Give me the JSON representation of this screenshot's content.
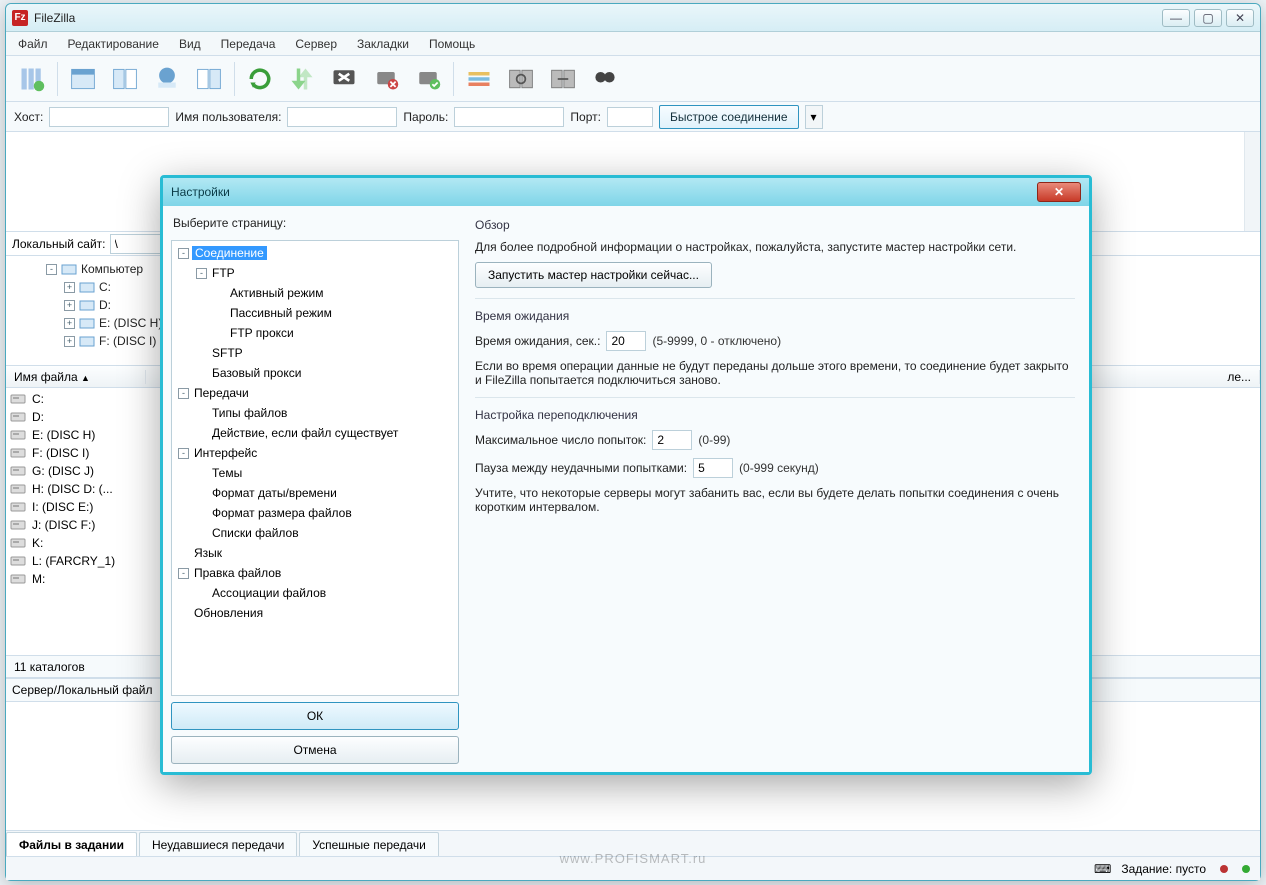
{
  "app": {
    "title": "FileZilla"
  },
  "menu": [
    "Файл",
    "Редактирование",
    "Вид",
    "Передача",
    "Сервер",
    "Закладки",
    "Помощь"
  ],
  "quickconnect": {
    "host_label": "Хост:",
    "user_label": "Имя пользователя:",
    "pass_label": "Пароль:",
    "port_label": "Порт:",
    "button": "Быстрое соединение"
  },
  "local": {
    "site_label": "Локальный сайт:",
    "path": "\\",
    "tree": [
      {
        "label": "Компьютер",
        "indent": 0,
        "box": "-",
        "icon": "computer"
      },
      {
        "label": "C:",
        "indent": 1,
        "box": "+",
        "icon": "disk"
      },
      {
        "label": "D:",
        "indent": 1,
        "box": "+",
        "icon": "disk"
      },
      {
        "label": "E: (DISC H)",
        "indent": 1,
        "box": "+",
        "icon": "disk"
      },
      {
        "label": "F: (DISC I)",
        "indent": 1,
        "box": "+",
        "icon": "disk"
      }
    ],
    "col_name": "Имя файла",
    "files": [
      "C:",
      "D:",
      "E: (DISC H)",
      "F: (DISC I)",
      "G: (DISC J)",
      "H: (DISC D: (...",
      "I: (DISC E:)",
      "J: (DISC F:)",
      "K:",
      "L: (FARCRY_1)",
      "M:"
    ],
    "status": "11 каталогов"
  },
  "remote_col_partial": "ле...",
  "queue_header": "Сервер/Локальный файл",
  "tabs": {
    "queued": "Файлы в задании",
    "failed": "Неудавшиеся передачи",
    "ok": "Успешные передачи"
  },
  "statusbar": {
    "queue_label": "Задание: пусто"
  },
  "watermark": "www.PROFISMART.ru",
  "dialog": {
    "title": "Настройки",
    "select_page": "Выберите страницу:",
    "ok": "ОК",
    "cancel": "Отмена",
    "tree": [
      {
        "label": "Соединение",
        "indent": 0,
        "box": "-",
        "sel": true
      },
      {
        "label": "FTP",
        "indent": 1,
        "box": "-"
      },
      {
        "label": "Активный режим",
        "indent": 2
      },
      {
        "label": "Пассивный режим",
        "indent": 2
      },
      {
        "label": "FTP прокси",
        "indent": 2
      },
      {
        "label": "SFTP",
        "indent": 1
      },
      {
        "label": "Базовый прокси",
        "indent": 1
      },
      {
        "label": "Передачи",
        "indent": 0,
        "box": "-"
      },
      {
        "label": "Типы файлов",
        "indent": 1
      },
      {
        "label": "Действие, если файл существует",
        "indent": 1
      },
      {
        "label": "Интерфейс",
        "indent": 0,
        "box": "-"
      },
      {
        "label": "Темы",
        "indent": 1
      },
      {
        "label": "Формат даты/времени",
        "indent": 1
      },
      {
        "label": "Формат размера файлов",
        "indent": 1
      },
      {
        "label": "Списки файлов",
        "indent": 1
      },
      {
        "label": "Язык",
        "indent": 0
      },
      {
        "label": "Правка файлов",
        "indent": 0,
        "box": "-"
      },
      {
        "label": "Ассоциации файлов",
        "indent": 1
      },
      {
        "label": "Обновления",
        "indent": 0
      }
    ],
    "panel": {
      "overview_title": "Обзор",
      "overview_text": "Для более подробной информации о настройках, пожалуйста, запустите мастер настройки сети.",
      "wizard_button": "Запустить мастер настройки сейчас...",
      "timeout_title": "Время ожидания",
      "timeout_label": "Время ожидания, сек.:",
      "timeout_value": "20",
      "timeout_hint": "(5-9999, 0 - отключено)",
      "timeout_text": "Если во время операции данные не будут переданы дольше этого времени, то соединение будет закрыто и FileZilla попытается подключиться заново.",
      "reconnect_title": "Настройка переподключения",
      "retries_label": "Максимальное число попыток:",
      "retries_value": "2",
      "retries_hint": "(0-99)",
      "delay_label": "Пауза между неудачными попытками:",
      "delay_value": "5",
      "delay_hint": "(0-999 секунд)",
      "reconnect_text": "Учтите, что некоторые серверы могут забанить вас, если вы будете делать попытки соединения с очень коротким интервалом."
    }
  }
}
